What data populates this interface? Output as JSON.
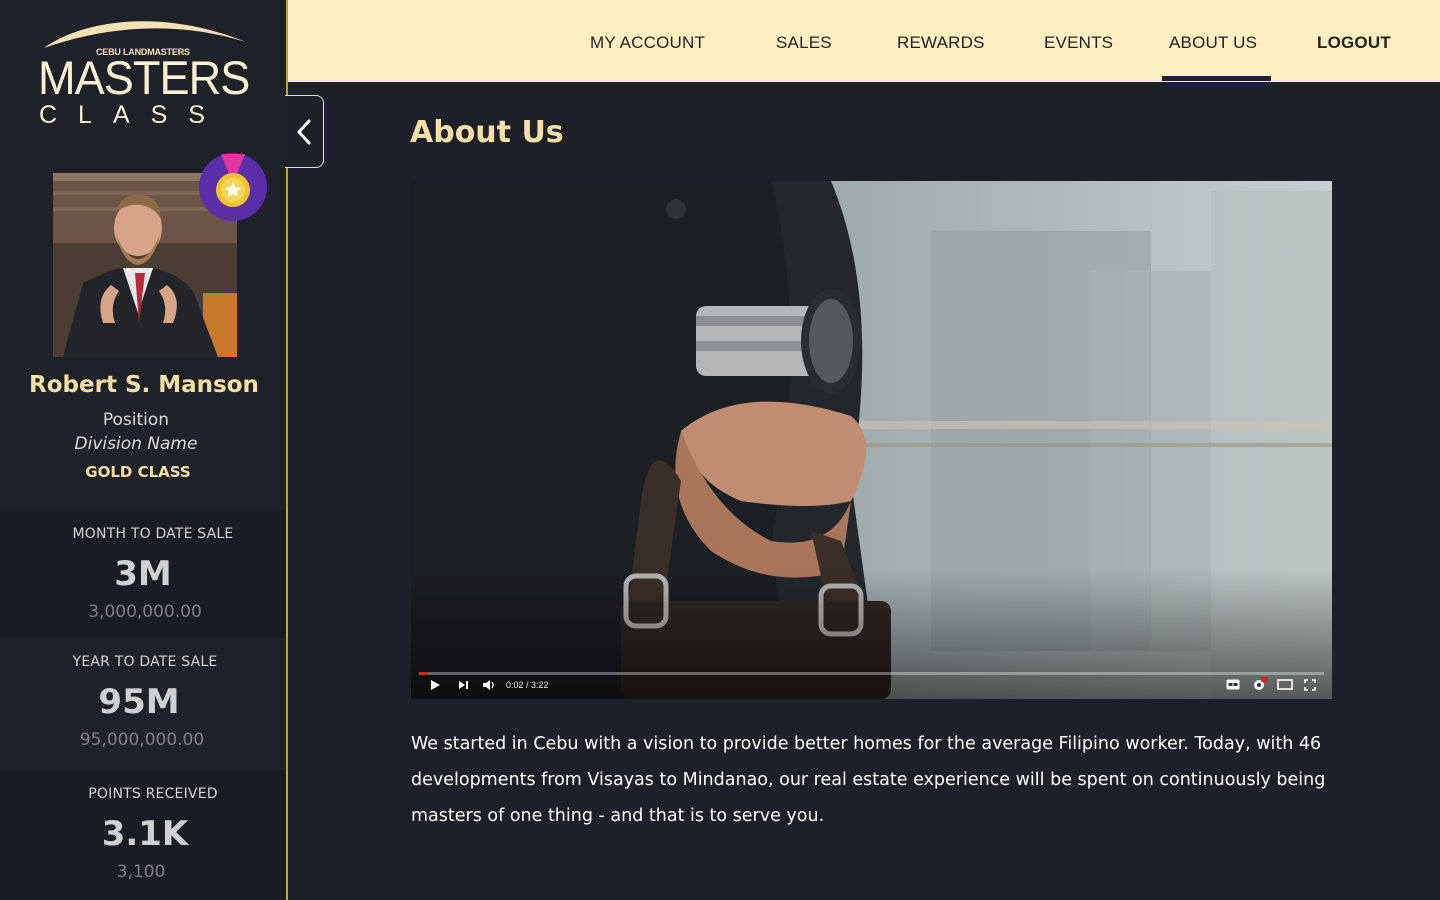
{
  "brand": {
    "small": "CEBU LANDMASTERS",
    "title": "MASTERS",
    "subtitle": "CLASS"
  },
  "user": {
    "name": "Robert S. Manson",
    "position": "Position",
    "division": "Division Name",
    "class": "GOLD CLASS"
  },
  "stats": [
    {
      "label": "MONTH TO DATE SALE",
      "big": "3M",
      "small": "3,000,000.00"
    },
    {
      "label": "YEAR TO DATE SALE",
      "big": "95M",
      "small": "95,000,000.00"
    },
    {
      "label": "POINTS RECEIVED",
      "big": "3.1K",
      "small": "3,100"
    }
  ],
  "nav": {
    "items": [
      "MY ACCOUNT",
      "SALES",
      "REWARDS",
      "EVENTS",
      "ABOUT US"
    ],
    "logout": "LOGOUT",
    "active": "ABOUT US"
  },
  "main": {
    "title": "About Us",
    "video": {
      "time": "0:02 / 3:22",
      "progress": 0.01
    },
    "paragraph": "We started in Cebu with a vision to provide better homes for the average Filipino worker. Today, with 46 developments from Visayas to Mindanao, our real estate experience will be spent on continuously being masters of one thing - and that is to serve you."
  },
  "colors": {
    "accent": "#f6e0a6",
    "nav_bg": "#fdefc2",
    "sidebar_bg": "#1f2129",
    "page_bg": "#1e2029",
    "progress": "#e62117"
  },
  "icons": [
    "back-chevron-icon",
    "medal-icon",
    "play-icon",
    "next-icon",
    "volume-icon",
    "captions-icon",
    "settings-icon",
    "theater-icon",
    "fullscreen-icon"
  ]
}
